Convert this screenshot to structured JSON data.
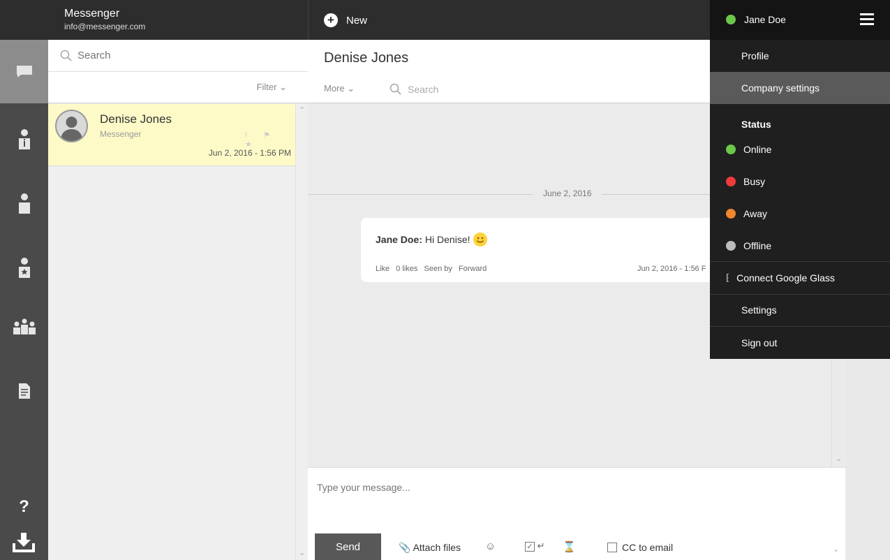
{
  "colors": {
    "online": "#6cc84a",
    "busy": "#ef3b3b",
    "away": "#f0862e",
    "offline": "#bdbdbd",
    "selected_row": "#fdfac8",
    "topbar": "#2d2d2d"
  },
  "header": {
    "app_name": "Messenger",
    "app_email": "info@messenger.com",
    "new_label": "New"
  },
  "nav": {
    "icons": [
      "chat-icon",
      "contact-info-icon",
      "user-icon",
      "favorite-user-icon",
      "group-icon",
      "document-icon",
      "help-icon",
      "download-icon"
    ],
    "help_label": "?"
  },
  "list": {
    "search_placeholder": "Search",
    "filter_label": "Filter",
    "conversations": [
      {
        "name": "Denise Jones",
        "source": "Messenger",
        "time": "Jun 2, 2016 - 1:56 PM",
        "flags": "! ⚑ ★"
      }
    ]
  },
  "chat": {
    "title": "Denise Jones",
    "more_label": "More",
    "search_placeholder": "Search",
    "date_divider": "June 2, 2016",
    "message": {
      "author": "Jane Doe:",
      "text": "Hi Denise!",
      "like": "Like",
      "likes": "0 likes",
      "seen": "Seen by",
      "forward": "Forward",
      "time": "Jun 2, 2016 - 1:56 F"
    }
  },
  "composer": {
    "placeholder": "Type your message...",
    "send_label": "Send",
    "attach_label": "Attach files",
    "enter_label": "↵",
    "cc_label": "CC to email"
  },
  "menu": {
    "user": "Jane Doe",
    "profile": "Profile",
    "company_settings": "Company settings",
    "status_label": "Status",
    "statuses": [
      {
        "label": "Online",
        "color": "#6cc84a"
      },
      {
        "label": "Busy",
        "color": "#ef3b3b"
      },
      {
        "label": "Away",
        "color": "#f0862e"
      },
      {
        "label": "Offline",
        "color": "#bdbdbd"
      }
    ],
    "glass": "Connect Google Glass",
    "settings": "Settings",
    "sign_out": "Sign out"
  }
}
